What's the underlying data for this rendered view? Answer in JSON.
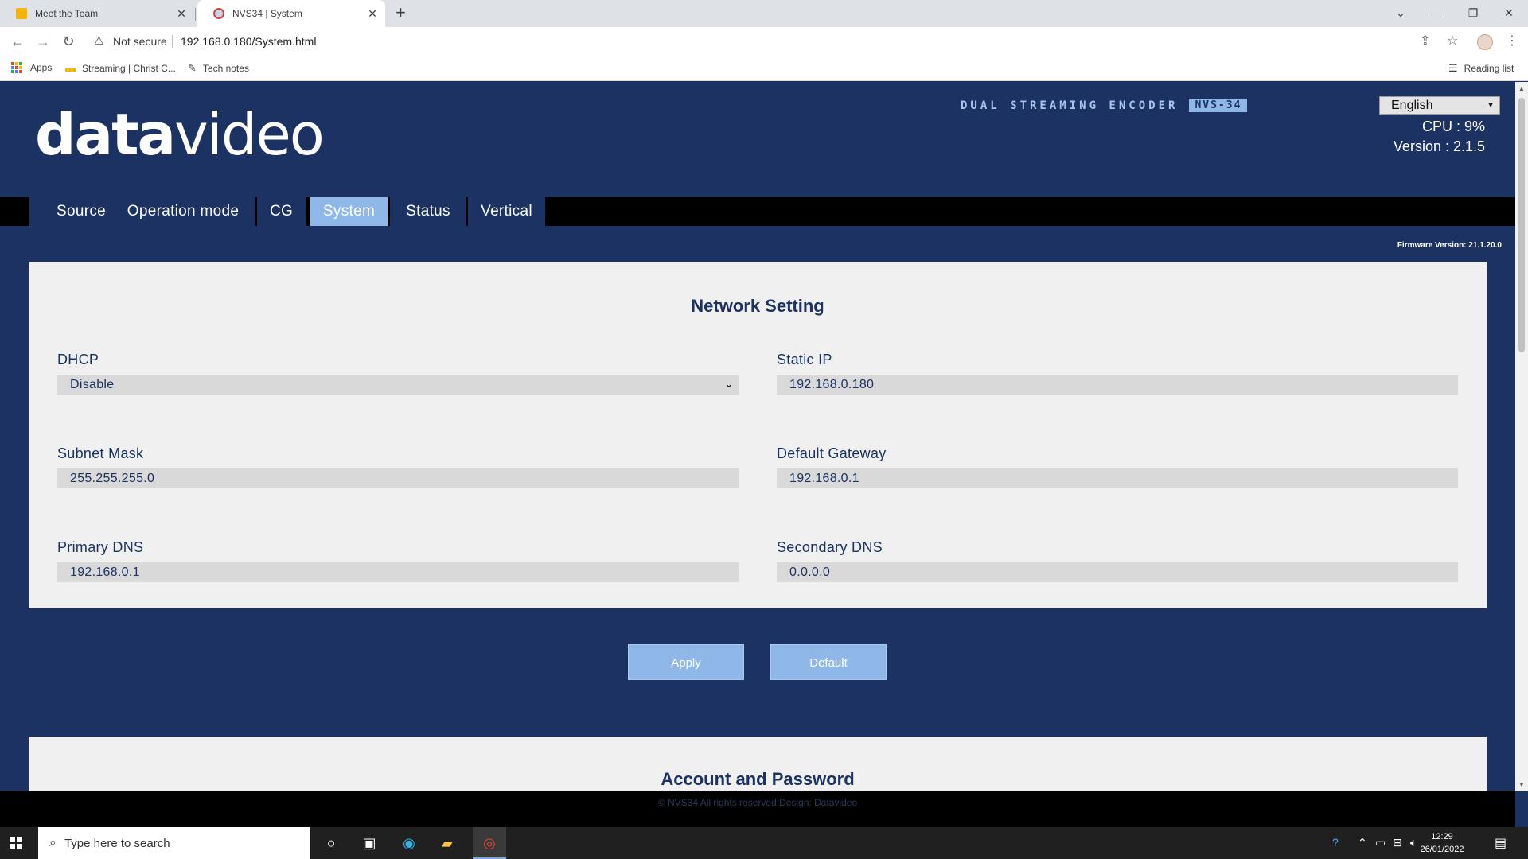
{
  "browser": {
    "tabs": [
      {
        "title": "Meet the Team",
        "active": false
      },
      {
        "title": "NVS34 | System",
        "active": true
      }
    ],
    "security_label": "Not secure",
    "url": "192.168.0.180/System.html",
    "bookmarks": [
      {
        "label": "Apps"
      },
      {
        "label": "Streaming | Christ C..."
      },
      {
        "label": "Tech notes"
      }
    ],
    "reading_list": "Reading list"
  },
  "header": {
    "logo_bold": "data",
    "logo_light": "video",
    "product_title": "DUAL STREAMING ENCODER",
    "product_model": "NVS-34",
    "language": "English",
    "cpu": "CPU  : 9%",
    "version": "Version : 2.1.5"
  },
  "nav": {
    "items": [
      {
        "label": "Source"
      },
      {
        "label": "Operation mode"
      },
      {
        "label": "CG"
      },
      {
        "label": "System"
      },
      {
        "label": "Status"
      },
      {
        "label": "Vertical"
      }
    ],
    "active": "System"
  },
  "firmware": "Firmware Version: 21.1.20.0",
  "network": {
    "title": "Network Setting",
    "dhcp": {
      "label": "DHCP",
      "value": "Disable"
    },
    "static_ip": {
      "label": "Static IP",
      "value": "192.168.0.180"
    },
    "subnet_mask": {
      "label": "Subnet Mask",
      "value": "255.255.255.0"
    },
    "default_gateway": {
      "label": "Default Gateway",
      "value": "192.168.0.1"
    },
    "primary_dns": {
      "label": "Primary DNS",
      "value": "192.168.0.1"
    },
    "secondary_dns": {
      "label": "Secondary DNS",
      "value": "0.0.0.0"
    }
  },
  "buttons": {
    "apply": "Apply",
    "default": "Default"
  },
  "account": {
    "title": "Account and Password"
  },
  "footer": {
    "copyright": "© NVS34 All rights reserved Design: Datavideo"
  },
  "taskbar": {
    "search_placeholder": "Type here to search",
    "time": "12:29",
    "date": "26/01/2022"
  },
  "colors": {
    "page_bg": "#1b3263",
    "accent": "#8fb8e8",
    "panel_bg": "#f0f0f0",
    "nav_bar": "#000000"
  }
}
